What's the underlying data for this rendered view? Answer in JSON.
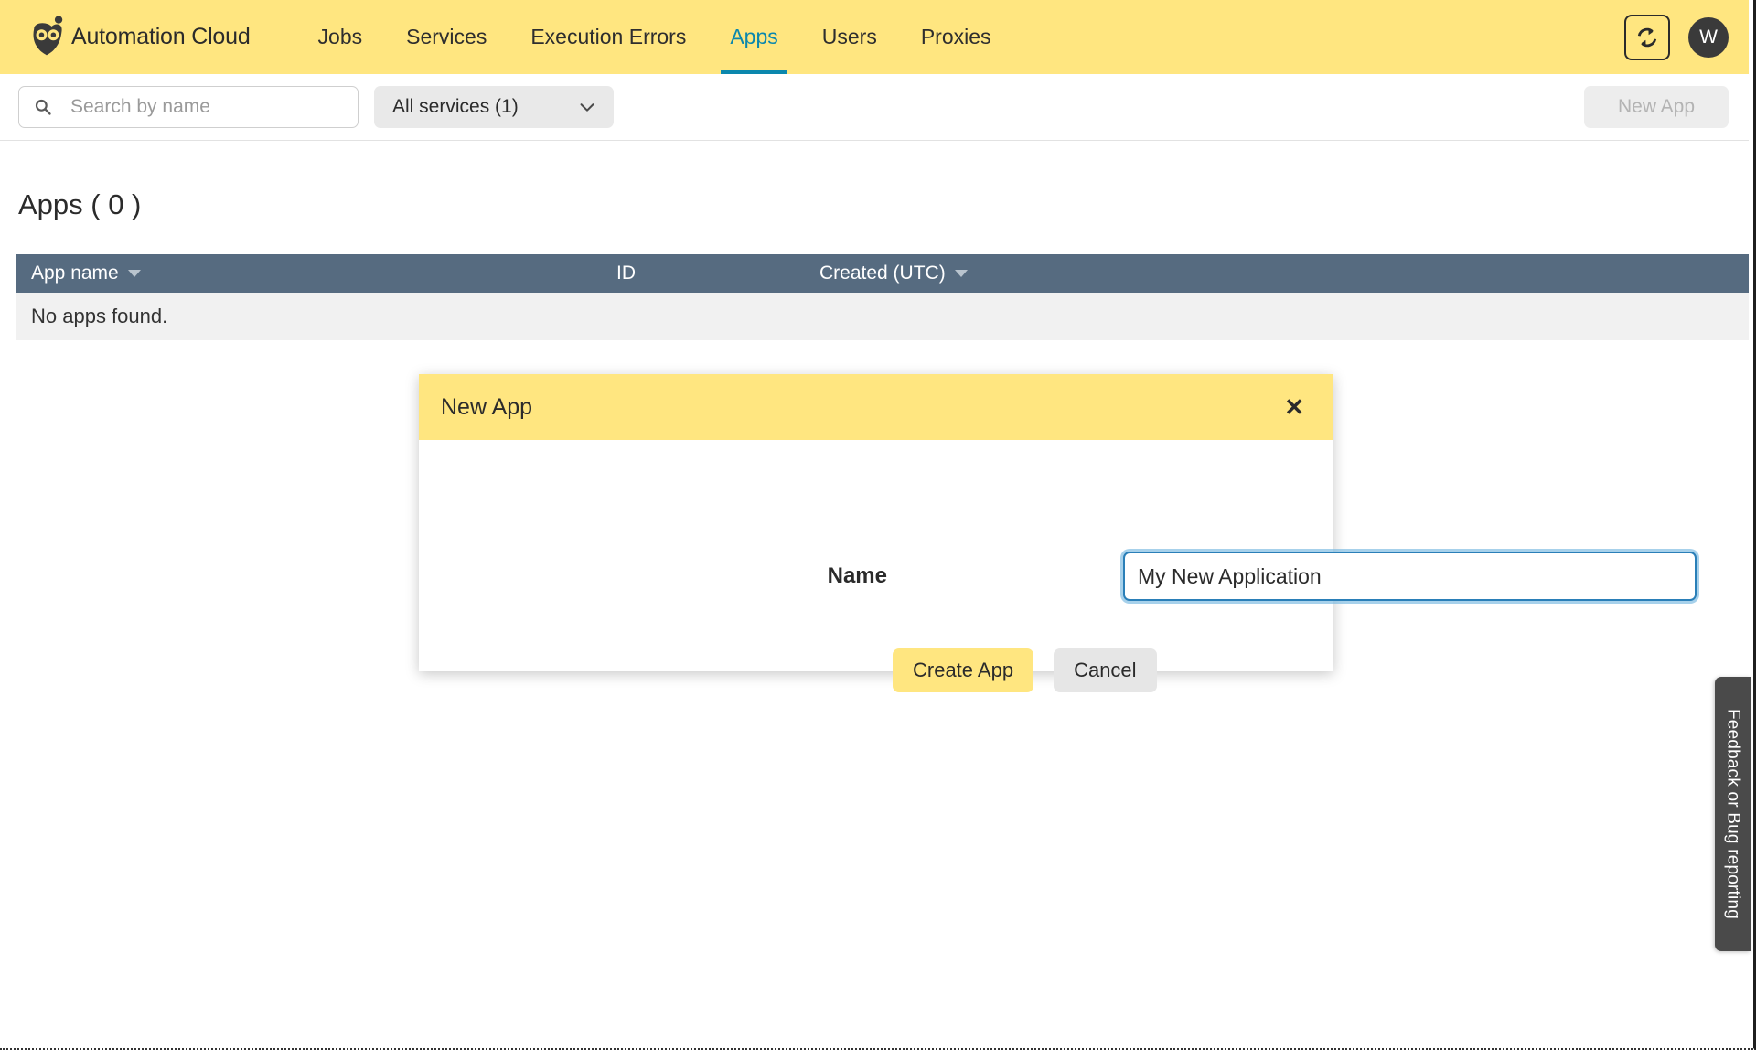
{
  "navbar": {
    "brand": "Automation Cloud",
    "brand_icon": "owl-logo-icon",
    "links": [
      {
        "label": "Jobs",
        "active": false
      },
      {
        "label": "Services",
        "active": false
      },
      {
        "label": "Execution Errors",
        "active": false
      },
      {
        "label": "Apps",
        "active": true
      },
      {
        "label": "Users",
        "active": false
      },
      {
        "label": "Proxies",
        "active": false
      }
    ],
    "refresh_icon": "refresh-icon",
    "avatar_initial": "W",
    "background_color": "#ffe680",
    "active_link_color": "#0b87ad"
  },
  "filterbar": {
    "search_placeholder": "Search by name",
    "search_value": "",
    "search_icon": "search-icon",
    "service_filter_label": "All services (1)",
    "service_filter_chevron": "chevron-down-icon",
    "new_app_label": "New App",
    "new_app_disabled": true
  },
  "main": {
    "page_title": "Apps ( 0 )",
    "table": {
      "columns": [
        {
          "label": "App name",
          "sortable": true
        },
        {
          "label": "ID",
          "sortable": false
        },
        {
          "label": "Created (UTC)",
          "sortable": true
        }
      ],
      "rows": [],
      "empty_message": "No apps found.",
      "header_background": "#566b80",
      "empty_row_background": "#f1f1f1"
    }
  },
  "modal": {
    "title": "New App",
    "close_icon": "close-icon",
    "name_label": "Name",
    "name_value": "My New Application",
    "name_placeholder": "",
    "create_label": "Create App",
    "cancel_label": "Cancel",
    "header_color": "#ffe680",
    "focus_ring_color": "#2a7fb8"
  },
  "feedback": {
    "label": "Feedback or Bug reporting",
    "background_color": "#4a4a4a"
  }
}
